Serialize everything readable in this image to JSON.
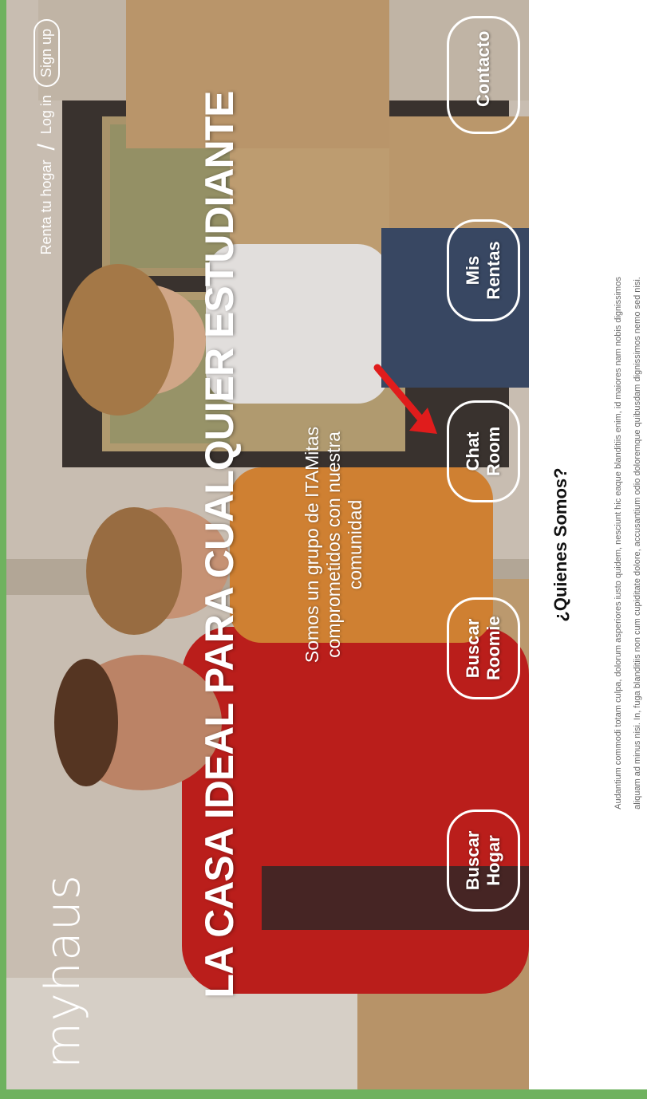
{
  "brand": {
    "logo": "myhaus"
  },
  "nav": {
    "rent_home": "Renta tu hogar",
    "separator": "/",
    "login": "Log in",
    "signup": "Sign up"
  },
  "hero": {
    "title": "LA CASA IDEAL PARA CUALQUIER ESTUDIANTE",
    "subtitle_lines": [
      "Somos un grupo de ITAMitas",
      "comprometidos con nuestra",
      "comunidad"
    ]
  },
  "buttons": {
    "buscar_hogar": "Buscar Hogar",
    "buscar_roomie": "Buscar Roomie",
    "chat_room": "Chat Room",
    "mis_rentas": "Mis Rentas",
    "contacto": "Contacto"
  },
  "about": {
    "title": "¿Quienes Somos?",
    "lines": [
      "Audantium commodi totam culpa, dolorum asperiores iusto quidem, nesciunt hic eaque blanditiis enim, id maiores nam nobis dignissimos",
      "aliquam ad minus nisi. In, fuga blanditiis non cum cupiditate dolore, accusantium odio doloremque quibusdam dignissimos nemo sed nisi."
    ]
  },
  "colors": {
    "frame": "#6fb25f",
    "arrow": "#e01c1c",
    "accent_text": "#ffffff"
  }
}
